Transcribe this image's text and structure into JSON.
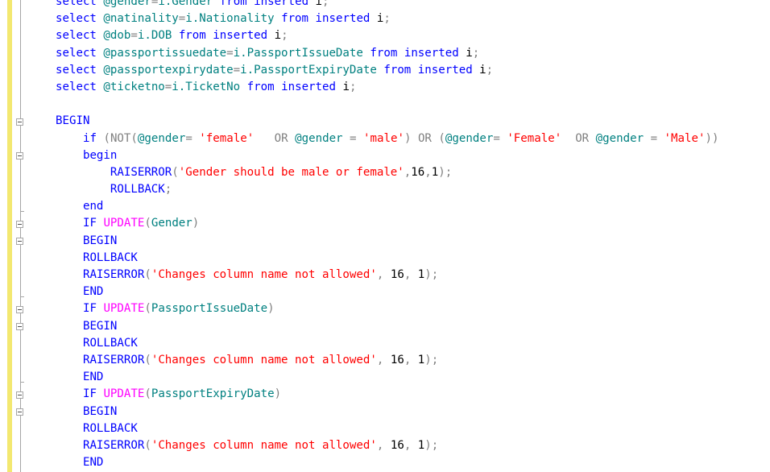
{
  "editor": {
    "lines": [
      [
        {
          "t": "select",
          "c": "kw"
        },
        {
          "t": " ",
          "c": "txt"
        },
        {
          "t": "@gender",
          "c": "var"
        },
        {
          "t": "=",
          "c": "op"
        },
        {
          "t": "i.Gender",
          "c": "var"
        },
        {
          "t": " ",
          "c": "txt"
        },
        {
          "t": "from",
          "c": "kw"
        },
        {
          "t": " ",
          "c": "txt"
        },
        {
          "t": "inserted",
          "c": "kw"
        },
        {
          "t": " i",
          "c": "txt"
        },
        {
          "t": ";",
          "c": "op"
        }
      ],
      [
        {
          "t": "select",
          "c": "kw"
        },
        {
          "t": " ",
          "c": "txt"
        },
        {
          "t": "@natinality",
          "c": "var"
        },
        {
          "t": "=",
          "c": "op"
        },
        {
          "t": "i.Nationality",
          "c": "var"
        },
        {
          "t": " ",
          "c": "txt"
        },
        {
          "t": "from",
          "c": "kw"
        },
        {
          "t": " ",
          "c": "txt"
        },
        {
          "t": "inserted",
          "c": "kw"
        },
        {
          "t": " i",
          "c": "txt"
        },
        {
          "t": ";",
          "c": "op"
        }
      ],
      [
        {
          "t": "select",
          "c": "kw"
        },
        {
          "t": " ",
          "c": "txt"
        },
        {
          "t": "@dob",
          "c": "var"
        },
        {
          "t": "=",
          "c": "op"
        },
        {
          "t": "i.DOB",
          "c": "var"
        },
        {
          "t": " ",
          "c": "txt"
        },
        {
          "t": "from",
          "c": "kw"
        },
        {
          "t": " ",
          "c": "txt"
        },
        {
          "t": "inserted",
          "c": "kw"
        },
        {
          "t": " i",
          "c": "txt"
        },
        {
          "t": ";",
          "c": "op"
        }
      ],
      [
        {
          "t": "select",
          "c": "kw"
        },
        {
          "t": " ",
          "c": "txt"
        },
        {
          "t": "@passportissuedate",
          "c": "var"
        },
        {
          "t": "=",
          "c": "op"
        },
        {
          "t": "i.PassportIssueDate",
          "c": "var"
        },
        {
          "t": " ",
          "c": "txt"
        },
        {
          "t": "from",
          "c": "kw"
        },
        {
          "t": " ",
          "c": "txt"
        },
        {
          "t": "inserted",
          "c": "kw"
        },
        {
          "t": " i",
          "c": "txt"
        },
        {
          "t": ";",
          "c": "op"
        }
      ],
      [
        {
          "t": "select",
          "c": "kw"
        },
        {
          "t": " ",
          "c": "txt"
        },
        {
          "t": "@passportexpirydate",
          "c": "var"
        },
        {
          "t": "=",
          "c": "op"
        },
        {
          "t": "i.PassportExpiryDate",
          "c": "var"
        },
        {
          "t": " ",
          "c": "txt"
        },
        {
          "t": "from",
          "c": "kw"
        },
        {
          "t": " ",
          "c": "txt"
        },
        {
          "t": "inserted",
          "c": "kw"
        },
        {
          "t": " i",
          "c": "txt"
        },
        {
          "t": ";",
          "c": "op"
        }
      ],
      [
        {
          "t": "select",
          "c": "kw"
        },
        {
          "t": " ",
          "c": "txt"
        },
        {
          "t": "@ticketno",
          "c": "var"
        },
        {
          "t": "=",
          "c": "op"
        },
        {
          "t": "i.TicketNo",
          "c": "var"
        },
        {
          "t": " ",
          "c": "txt"
        },
        {
          "t": "from",
          "c": "kw"
        },
        {
          "t": " ",
          "c": "txt"
        },
        {
          "t": "inserted",
          "c": "kw"
        },
        {
          "t": " i",
          "c": "txt"
        },
        {
          "t": ";",
          "c": "op"
        }
      ],
      [],
      [
        {
          "t": "BEGIN",
          "c": "kw"
        }
      ],
      [
        {
          "t": "    ",
          "c": "txt"
        },
        {
          "t": "if",
          "c": "kw"
        },
        {
          "t": " ",
          "c": "txt"
        },
        {
          "t": "(",
          "c": "op"
        },
        {
          "t": "NOT",
          "c": "op"
        },
        {
          "t": "(",
          "c": "op"
        },
        {
          "t": "@gender",
          "c": "var"
        },
        {
          "t": "= ",
          "c": "op"
        },
        {
          "t": "'female'",
          "c": "str"
        },
        {
          "t": "   ",
          "c": "txt"
        },
        {
          "t": "OR",
          "c": "op"
        },
        {
          "t": " ",
          "c": "txt"
        },
        {
          "t": "@gender",
          "c": "var"
        },
        {
          "t": " = ",
          "c": "op"
        },
        {
          "t": "'male'",
          "c": "str"
        },
        {
          "t": ")",
          "c": "op"
        },
        {
          "t": " ",
          "c": "txt"
        },
        {
          "t": "OR",
          "c": "op"
        },
        {
          "t": " ",
          "c": "txt"
        },
        {
          "t": "(",
          "c": "op"
        },
        {
          "t": "@gender",
          "c": "var"
        },
        {
          "t": "= ",
          "c": "op"
        },
        {
          "t": "'Female'",
          "c": "str"
        },
        {
          "t": "  ",
          "c": "txt"
        },
        {
          "t": "OR",
          "c": "op"
        },
        {
          "t": " ",
          "c": "txt"
        },
        {
          "t": "@gender",
          "c": "var"
        },
        {
          "t": " = ",
          "c": "op"
        },
        {
          "t": "'Male'",
          "c": "str"
        },
        {
          "t": "))",
          "c": "op"
        }
      ],
      [
        {
          "t": "    ",
          "c": "txt"
        },
        {
          "t": "begin",
          "c": "kw"
        }
      ],
      [
        {
          "t": "        ",
          "c": "txt"
        },
        {
          "t": "RAISERROR",
          "c": "kw"
        },
        {
          "t": "(",
          "c": "op"
        },
        {
          "t": "'Gender should be male or female'",
          "c": "str"
        },
        {
          "t": ",",
          "c": "op"
        },
        {
          "t": "16",
          "c": "txt"
        },
        {
          "t": ",",
          "c": "op"
        },
        {
          "t": "1",
          "c": "txt"
        },
        {
          "t": ");",
          "c": "op"
        }
      ],
      [
        {
          "t": "        ",
          "c": "txt"
        },
        {
          "t": "ROLLBACK",
          "c": "kw"
        },
        {
          "t": ";",
          "c": "op"
        }
      ],
      [
        {
          "t": "    ",
          "c": "txt"
        },
        {
          "t": "end",
          "c": "kw"
        }
      ],
      [
        {
          "t": "    ",
          "c": "txt"
        },
        {
          "t": "IF",
          "c": "kw"
        },
        {
          "t": " ",
          "c": "txt"
        },
        {
          "t": "UPDATE",
          "c": "fn"
        },
        {
          "t": "(",
          "c": "op"
        },
        {
          "t": "Gender",
          "c": "var"
        },
        {
          "t": ")",
          "c": "op"
        }
      ],
      [
        {
          "t": "    ",
          "c": "txt"
        },
        {
          "t": "BEGIN",
          "c": "kw"
        }
      ],
      [
        {
          "t": "    ",
          "c": "txt"
        },
        {
          "t": "ROLLBACK",
          "c": "kw"
        }
      ],
      [
        {
          "t": "    ",
          "c": "txt"
        },
        {
          "t": "RAISERROR",
          "c": "kw"
        },
        {
          "t": "(",
          "c": "op"
        },
        {
          "t": "'Changes column name not allowed'",
          "c": "str"
        },
        {
          "t": ",",
          "c": "op"
        },
        {
          "t": " 16",
          "c": "txt"
        },
        {
          "t": ",",
          "c": "op"
        },
        {
          "t": " 1",
          "c": "txt"
        },
        {
          "t": ");",
          "c": "op"
        }
      ],
      [
        {
          "t": "    ",
          "c": "txt"
        },
        {
          "t": "END",
          "c": "kw"
        }
      ],
      [
        {
          "t": "    ",
          "c": "txt"
        },
        {
          "t": "IF",
          "c": "kw"
        },
        {
          "t": " ",
          "c": "txt"
        },
        {
          "t": "UPDATE",
          "c": "fn"
        },
        {
          "t": "(",
          "c": "op"
        },
        {
          "t": "PassportIssueDate",
          "c": "var"
        },
        {
          "t": ")",
          "c": "op"
        }
      ],
      [
        {
          "t": "    ",
          "c": "txt"
        },
        {
          "t": "BEGIN",
          "c": "kw"
        }
      ],
      [
        {
          "t": "    ",
          "c": "txt"
        },
        {
          "t": "ROLLBACK",
          "c": "kw"
        }
      ],
      [
        {
          "t": "    ",
          "c": "txt"
        },
        {
          "t": "RAISERROR",
          "c": "kw"
        },
        {
          "t": "(",
          "c": "op"
        },
        {
          "t": "'Changes column name not allowed'",
          "c": "str"
        },
        {
          "t": ",",
          "c": "op"
        },
        {
          "t": " 16",
          "c": "txt"
        },
        {
          "t": ",",
          "c": "op"
        },
        {
          "t": " 1",
          "c": "txt"
        },
        {
          "t": ");",
          "c": "op"
        }
      ],
      [
        {
          "t": "    ",
          "c": "txt"
        },
        {
          "t": "END",
          "c": "kw"
        }
      ],
      [
        {
          "t": "    ",
          "c": "txt"
        },
        {
          "t": "IF",
          "c": "kw"
        },
        {
          "t": " ",
          "c": "txt"
        },
        {
          "t": "UPDATE",
          "c": "fn"
        },
        {
          "t": "(",
          "c": "op"
        },
        {
          "t": "PassportExpiryDate",
          "c": "var"
        },
        {
          "t": ")",
          "c": "op"
        }
      ],
      [
        {
          "t": "    ",
          "c": "txt"
        },
        {
          "t": "BEGIN",
          "c": "kw"
        }
      ],
      [
        {
          "t": "    ",
          "c": "txt"
        },
        {
          "t": "ROLLBACK",
          "c": "kw"
        }
      ],
      [
        {
          "t": "    ",
          "c": "txt"
        },
        {
          "t": "RAISERROR",
          "c": "kw"
        },
        {
          "t": "(",
          "c": "op"
        },
        {
          "t": "'Changes column name not allowed'",
          "c": "str"
        },
        {
          "t": ",",
          "c": "op"
        },
        {
          "t": " 16",
          "c": "txt"
        },
        {
          "t": ",",
          "c": "op"
        },
        {
          "t": " 1",
          "c": "txt"
        },
        {
          "t": ");",
          "c": "op"
        }
      ],
      [
        {
          "t": "    ",
          "c": "txt"
        },
        {
          "t": "END",
          "c": "kw"
        }
      ]
    ]
  },
  "syntax_colors": {
    "keyword": "#0000ff",
    "function": "#ff00ff",
    "identifier": "#008080",
    "string": "#ff0000",
    "operator": "#808080",
    "text": "#000000",
    "change_bar": "#f3e870"
  }
}
